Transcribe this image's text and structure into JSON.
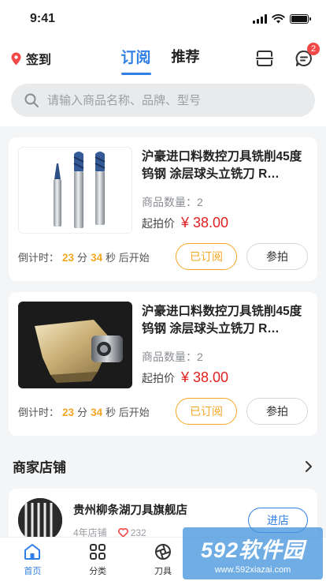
{
  "status_bar": {
    "time": "9:41"
  },
  "header": {
    "checkin_label": "签到",
    "tabs": [
      {
        "label": "订阅",
        "active": true
      },
      {
        "label": "推荐",
        "active": false
      }
    ],
    "message_badge": "2"
  },
  "search": {
    "placeholder": "请输入商品名称、品牌、型号"
  },
  "cards": [
    {
      "title": "沪豪进口料数控刀具铣削45度钨钢 涂层球头立铣刀 R…",
      "qty_label": "商品数量：2",
      "price_label": "起拍价",
      "price": "¥ 38.00",
      "countdown_prefix": "倒计时：",
      "minutes": "23",
      "minutes_unit": "分",
      "seconds": "34",
      "seconds_unit": "秒 后开始",
      "subscribed_label": "已订阅",
      "bid_label": "参拍"
    },
    {
      "title": "沪豪进口料数控刀具铣削45度钨钢 涂层球头立铣刀 R…",
      "qty_label": "商品数量：2",
      "price_label": "起拍价",
      "price": "¥ 38.00",
      "countdown_prefix": "倒计时：",
      "minutes": "23",
      "minutes_unit": "分",
      "seconds": "34",
      "seconds_unit": "秒 后开始",
      "subscribed_label": "已订阅",
      "bid_label": "参拍"
    }
  ],
  "shops_section": {
    "title": "商家店铺",
    "shop": {
      "name": "贵州柳条湖刀具旗舰店",
      "years": "4年店铺",
      "likes": "232",
      "enter_label": "进店"
    }
  },
  "tabbar": [
    {
      "label": "首页",
      "icon": "home-icon",
      "active": true
    },
    {
      "label": "分类",
      "icon": "grid-icon",
      "active": false
    },
    {
      "label": "刀具",
      "icon": "tool-icon",
      "active": false
    }
  ],
  "watermark": {
    "title": "592软件园",
    "url": "www.592xiazai.com"
  },
  "colors": {
    "accent": "#2f7fe6",
    "price": "#e02020",
    "countdown": "#f5a623",
    "badge": "#f24848"
  }
}
